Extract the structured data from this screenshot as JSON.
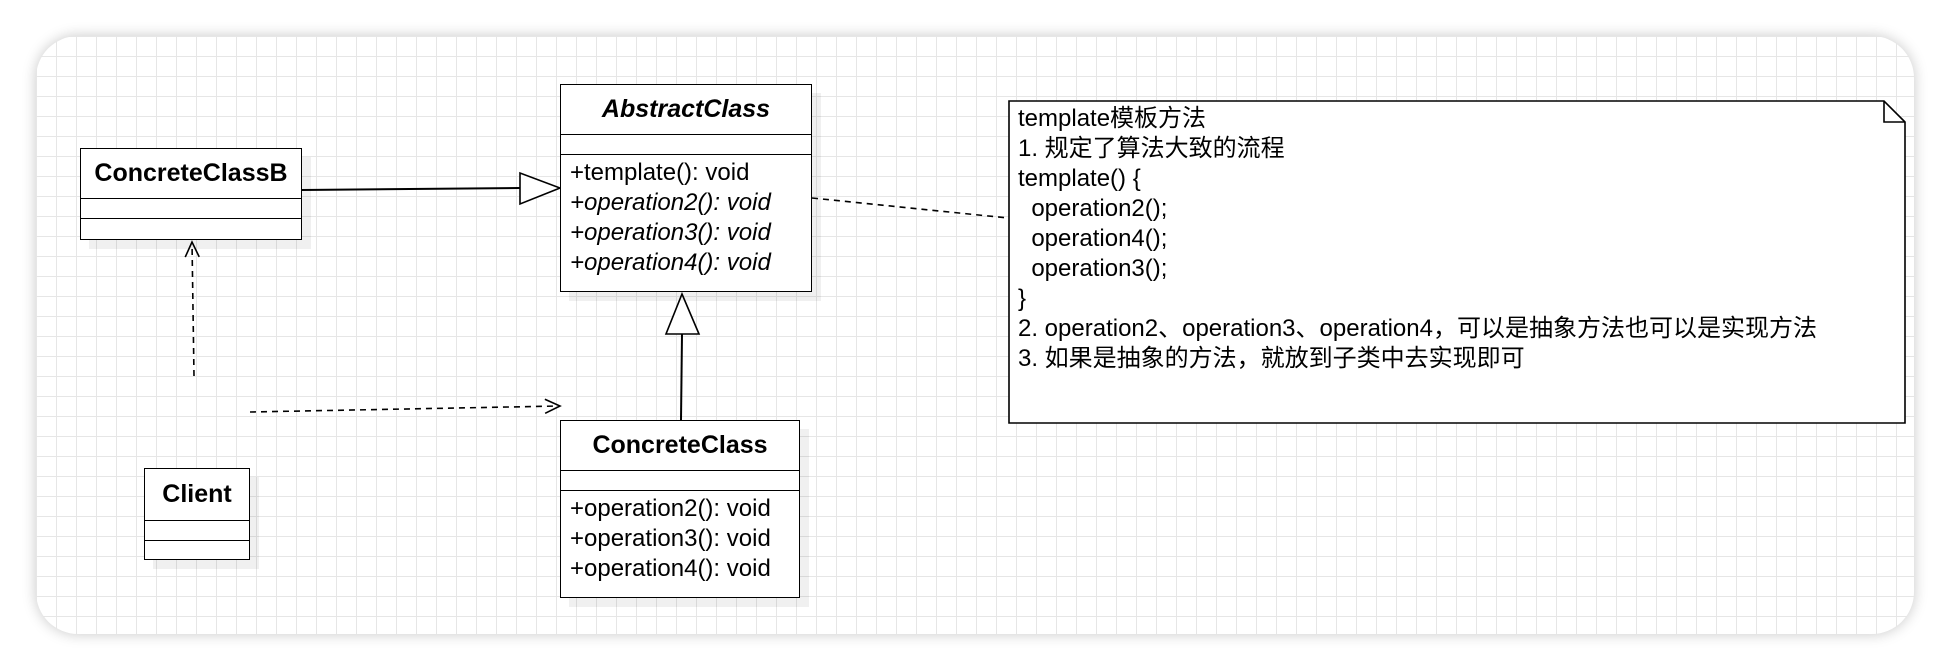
{
  "classes": {
    "abstract": {
      "name": "AbstractClass",
      "ops": [
        "+template(): void",
        "+operation2(): void",
        "+operation3(): void",
        "+operation4(): void"
      ]
    },
    "concrete_b": {
      "name": "ConcreteClassB"
    },
    "concrete": {
      "name": "ConcreteClass",
      "ops": [
        "+operation2(): void",
        "+operation3(): void",
        "+operation4(): void"
      ]
    },
    "client": {
      "name": "Client"
    }
  },
  "note": {
    "lines": [
      "template模板方法",
      "1. 规定了算法大致的流程",
      "template() {",
      "  operation2();",
      "  operation4();",
      "  operation3();",
      "}",
      "2. operation2、operation3、operation4，可以是抽象方法也可以是实现方法",
      "3. 如果是抽象的方法，就放到子类中去实现即可"
    ]
  },
  "colors": {
    "stroke": "#000000",
    "grid": "#e6e6e6",
    "background": "#ffffff"
  }
}
